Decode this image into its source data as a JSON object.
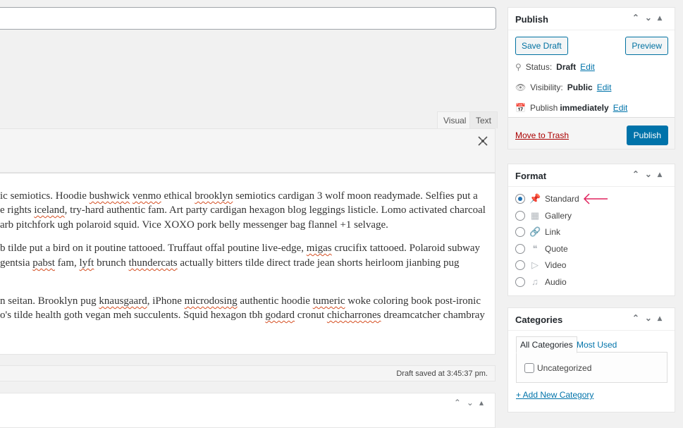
{
  "editor": {
    "tabs": [
      "Visual",
      "Text"
    ],
    "lines": [
      [
        [
          "ic semiotics. Hoodie ",
          0
        ],
        [
          "bushwick",
          1
        ],
        [
          " ",
          0
        ],
        [
          "venmo",
          1
        ],
        [
          " ethical ",
          0
        ],
        [
          "brooklyn",
          1
        ],
        [
          " semiotics cardigan 3 wolf moon readymade. Selfies put a",
          0
        ]
      ],
      [
        [
          "e rights ",
          0
        ],
        [
          "iceland",
          1
        ],
        [
          ", try-hard authentic fam. Art party cardigan hexagon blog leggings listicle. Lomo activated charcoal",
          0
        ]
      ],
      [
        [
          "arb pitchfork ugh polaroid squid. Vice XOXO pork belly messenger bag flannel +1 selvage.",
          0
        ]
      ],
      [
        [
          "b tilde put a bird on it poutine tattooed. Truffaut offal poutine live-edge, ",
          0
        ],
        [
          "migas",
          1
        ],
        [
          " crucifix tattooed. Polaroid subway",
          0
        ]
      ],
      [
        [
          "gentsia ",
          0
        ],
        [
          "pabst",
          1
        ],
        [
          " fam, ",
          0
        ],
        [
          "lyft",
          1
        ],
        [
          " brunch ",
          0
        ],
        [
          "thundercats",
          1
        ],
        [
          " actually bitters tilde direct trade jean shorts heirloom jianbing pug",
          0
        ]
      ],
      [
        [
          "n seitan. Brooklyn pug ",
          0
        ],
        [
          "knausgaard",
          1
        ],
        [
          ", iPhone ",
          0
        ],
        [
          "microdosing",
          1
        ],
        [
          " authentic hoodie ",
          0
        ],
        [
          "tumeric",
          1
        ],
        [
          " woke coloring book post-ironic",
          0
        ]
      ],
      [
        [
          "o's tilde health goth vegan meh succulents. Squid hexagon tbh ",
          0
        ],
        [
          "godard",
          1
        ],
        [
          " cronut ",
          0
        ],
        [
          "chicharrones",
          1
        ],
        [
          " dreamcatcher chambray",
          0
        ]
      ]
    ],
    "status": "Draft saved at 3:45:37 pm."
  },
  "publish": {
    "title": "Publish",
    "save_draft": "Save Draft",
    "preview": "Preview",
    "status_label": "Status:",
    "status_value": "Draft",
    "visibility_label": "Visibility:",
    "visibility_value": "Public",
    "publish_label": "Publish",
    "publish_value": "immediately",
    "edit": "Edit",
    "trash": "Move to Trash",
    "publish_btn": "Publish"
  },
  "format": {
    "title": "Format",
    "options": [
      {
        "label": "Standard",
        "icon": "pin-icon",
        "selected": true
      },
      {
        "label": "Gallery",
        "icon": "gallery-icon"
      },
      {
        "label": "Link",
        "icon": "link-icon"
      },
      {
        "label": "Quote",
        "icon": "quote-icon"
      },
      {
        "label": "Video",
        "icon": "video-icon"
      },
      {
        "label": "Audio",
        "icon": "audio-icon"
      }
    ],
    "arrow_color": "#e0245e"
  },
  "categories": {
    "title": "Categories",
    "tabs": [
      "All Categories",
      "Most Used"
    ],
    "items": [
      "Uncategorized"
    ],
    "add_new": "+ Add New Category"
  },
  "colors": {
    "primary": "#0073aa",
    "trash": "#a00"
  }
}
